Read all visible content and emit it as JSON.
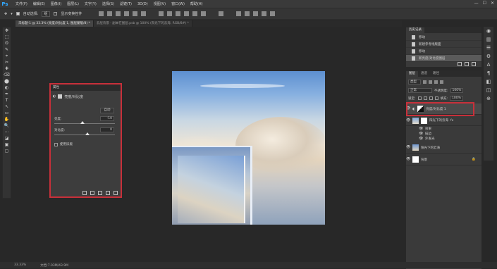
{
  "app": {
    "logo": "Ps"
  },
  "menubar": {
    "items": [
      "文件(F)",
      "编辑(E)",
      "图像(I)",
      "图层(L)",
      "文字(Y)",
      "选择(S)",
      "滤镜(T)",
      "3D(D)",
      "视图(V)",
      "窗口(W)",
      "帮助(H)"
    ],
    "window_controls": [
      "—",
      "☐",
      "✕"
    ]
  },
  "options_bar": {
    "auto_select_label": "自动选择:",
    "auto_select_value": "组",
    "show_transform_label": "显示变换控件"
  },
  "doc_tabs": [
    {
      "label": "未标题-1 @ 33.3% (亮度/对比度 1, 图层蒙版/8) *",
      "active": true
    },
    {
      "label": "云层背景 - 副本在图层.psb @ 100% (阳光下的云海, RGB/8#) *",
      "active": false
    }
  ],
  "toolbar": {
    "icons": [
      "✥",
      "⬚",
      "ʘ",
      "✎",
      "⌖",
      "✂",
      "✚",
      "⌫",
      "⬤",
      "◐",
      "✒",
      "T",
      "↖",
      "▭",
      "✋",
      "🔍",
      "⋯",
      "◪",
      "▣",
      "▢"
    ]
  },
  "properties_panel": {
    "header": "属性",
    "title": "亮度/对比度",
    "auto_button": "自动",
    "brightness_label": "亮度:",
    "brightness_value": "-10",
    "contrast_label": "对比度:",
    "contrast_value": "0",
    "legacy_label": "使用旧版",
    "brightness_frac": 0.46,
    "contrast_frac": 0.55
  },
  "history_panel": {
    "tabs": [
      "历史记录"
    ],
    "items": [
      {
        "label": "移动",
        "selected": false
      },
      {
        "label": "新建参考线版面",
        "selected": false
      },
      {
        "label": "移动",
        "selected": false
      },
      {
        "label": "新亮度/对比度图层",
        "selected": true
      }
    ]
  },
  "layers_panel": {
    "tabs": [
      "图层",
      "通道",
      "路径"
    ],
    "filter_label": "类型",
    "blend_mode": "正常",
    "opacity_label": "不透明度:",
    "opacity_value": "100%",
    "lock_label": "锁定:",
    "fill_label": "填充:",
    "fill_value": "100%",
    "layers": [
      {
        "name": "亮度/对比度 1",
        "kind": "adjustment"
      },
      {
        "name": "阳光下的云海",
        "kind": "fx",
        "fx_badge": "fx"
      },
      {
        "name": "阳光下的云海",
        "kind": "image"
      },
      {
        "name": "背景",
        "kind": "bg"
      }
    ],
    "effects_label": "效果",
    "effects": [
      "描边",
      "外发光"
    ]
  },
  "right_icons": [
    "◉",
    "▥",
    "☰",
    "⚙",
    "A",
    "¶",
    "◧",
    "◫",
    "⊕"
  ],
  "status": {
    "zoom": "33.33%",
    "doc_size": "文档:7.03M/43.9M"
  },
  "colors": {
    "highlight": "#c8303a",
    "accent": "#31a8ff"
  }
}
